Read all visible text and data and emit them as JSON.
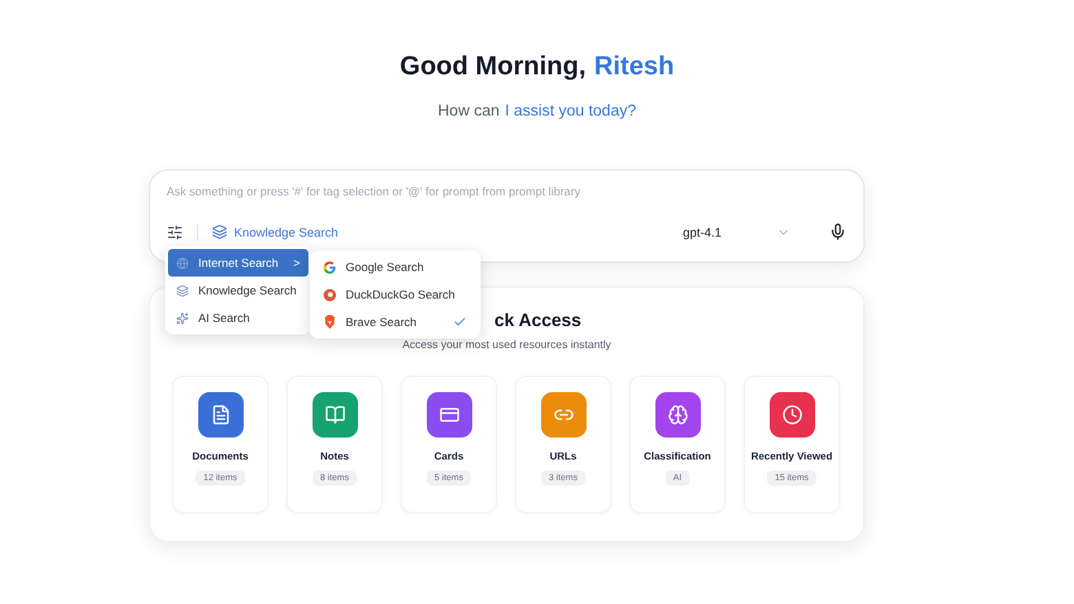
{
  "greeting": {
    "text": "Good Morning,",
    "name": "Ritesh"
  },
  "subtitle": {
    "prefix": "How can",
    "highlight": "I assist you today?"
  },
  "composer": {
    "placeholder": "Ask something or press '#' for tag selection or '@' for prompt from prompt library",
    "search_mode": "Knowledge Search",
    "model": "gpt-4.1"
  },
  "search_menu": {
    "items": [
      {
        "label": "Internet Search",
        "kind": "internet",
        "selected": true,
        "arrow": ">"
      },
      {
        "label": "Knowledge Search",
        "kind": "knowledge",
        "selected": false
      },
      {
        "label": "AI Search",
        "kind": "ai",
        "selected": false
      }
    ],
    "submenu": [
      {
        "label": "Google Search",
        "kind": "google",
        "checked": false
      },
      {
        "label": "DuckDuckGo Search",
        "kind": "duckduckgo",
        "checked": false
      },
      {
        "label": "Brave Search",
        "kind": "brave",
        "checked": true
      }
    ]
  },
  "quick_access": {
    "title": "ck Access",
    "subtitle": "Access your most used resources instantly",
    "items": [
      {
        "label": "Documents",
        "count": "12 items",
        "kind": "document",
        "color": "#3b6fd8"
      },
      {
        "label": "Notes",
        "count": "8 items",
        "kind": "book",
        "color": "#16a36f"
      },
      {
        "label": "Cards",
        "count": "5 items",
        "kind": "card",
        "color": "#8b4cf0"
      },
      {
        "label": "URLs",
        "count": "3 items",
        "kind": "link",
        "color": "#ec8c0c"
      },
      {
        "label": "Classification",
        "count": "AI",
        "kind": "brain",
        "color": "#a245ee"
      },
      {
        "label": "Recently Viewed",
        "count": "15 items",
        "kind": "clock",
        "color": "#e8304f"
      }
    ]
  }
}
